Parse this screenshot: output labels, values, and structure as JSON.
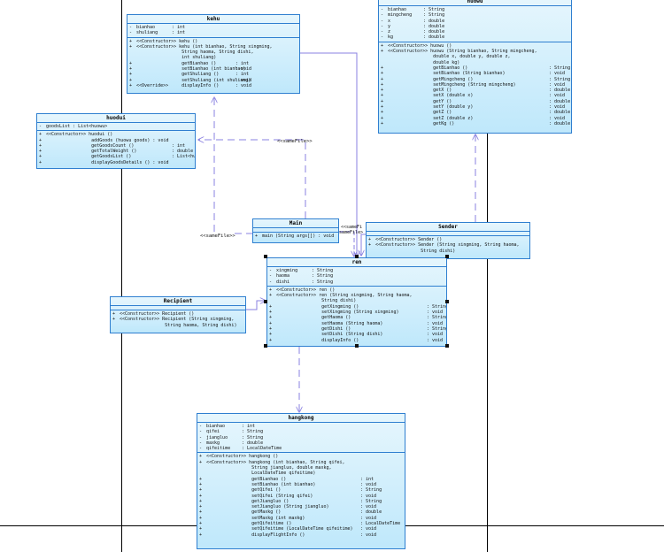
{
  "classes": {
    "kehu": {
      "name": "kehu",
      "attributes": [
        {
          "vis": "-",
          "name": "bianhao",
          "type": ": int"
        },
        {
          "vis": "-",
          "name": "shuliang",
          "type": ": int"
        }
      ],
      "operations": [
        {
          "vis": "+",
          "name": "<<Constructor>> kehu ()",
          "type": ""
        },
        {
          "vis": "+",
          "name": "<<Constructor>> kehu (int bianhao, String xingming,",
          "type": ""
        },
        {
          "vis": "",
          "name": "                 String haoma, String dishi,",
          "type": ""
        },
        {
          "vis": "",
          "name": "                 int shuliang)",
          "type": ""
        },
        {
          "vis": "+",
          "name": "                 getBianhao ()",
          "type": ": int"
        },
        {
          "vis": "+",
          "name": "                 setBianhao (int bianhao)",
          "type": ": void"
        },
        {
          "vis": "+",
          "name": "                 getShuliang ()",
          "type": ": int"
        },
        {
          "vis": "+",
          "name": "                 setShuliang (int shuliang)",
          "type": ": void"
        },
        {
          "vis": "+",
          "name": "<<Override>>     displayInfo ()",
          "type": ": void"
        }
      ]
    },
    "huowu": {
      "name": "huowu",
      "attributes": [
        {
          "vis": "-",
          "name": "bianhao",
          "type": ": String"
        },
        {
          "vis": "-",
          "name": "mingcheng",
          "type": ": String"
        },
        {
          "vis": "-",
          "name": "x",
          "type": ": double"
        },
        {
          "vis": "-",
          "name": "y",
          "type": ": double"
        },
        {
          "vis": "-",
          "name": "z",
          "type": ": double"
        },
        {
          "vis": "-",
          "name": "kg",
          "type": ": double"
        }
      ],
      "operations": [
        {
          "vis": "+",
          "name": "<<Constructor>> huowu ()",
          "type": ""
        },
        {
          "vis": "+",
          "name": "<<Constructor>> huowu (String bianhao, String mingcheng,",
          "type": ""
        },
        {
          "vis": "",
          "name": "                 double x, double y, double z,",
          "type": ""
        },
        {
          "vis": "",
          "name": "                 double kg)",
          "type": ""
        },
        {
          "vis": "+",
          "name": "                 getBianhao ()",
          "type": ": String"
        },
        {
          "vis": "+",
          "name": "                 setBianhao (String bianhao)",
          "type": ": void"
        },
        {
          "vis": "+",
          "name": "                 getMingcheng ()",
          "type": ": String"
        },
        {
          "vis": "+",
          "name": "                 setMingcheng (String mingcheng)",
          "type": ": void"
        },
        {
          "vis": "+",
          "name": "                 getX ()",
          "type": ": double"
        },
        {
          "vis": "+",
          "name": "                 setX (double x)",
          "type": ": void"
        },
        {
          "vis": "+",
          "name": "                 getY ()",
          "type": ": double"
        },
        {
          "vis": "+",
          "name": "                 setY (double y)",
          "type": ": void"
        },
        {
          "vis": "+",
          "name": "                 getZ ()",
          "type": ": double"
        },
        {
          "vis": "+",
          "name": "                 setZ (double z)",
          "type": ": void"
        },
        {
          "vis": "+",
          "name": "                 getKg ()",
          "type": ": double"
        }
      ]
    },
    "huodui": {
      "name": "huodui",
      "attributes": [
        {
          "vis": "-",
          "name": "goodsList : List<huowu>",
          "type": ""
        }
      ],
      "operations": [
        {
          "vis": "+",
          "name": "<<Constructor>> huodui ()",
          "type": ""
        },
        {
          "vis": "+",
          "name": "                 addGoods (huowu goods) : void",
          "type": ""
        },
        {
          "vis": "+",
          "name": "                 getGoodsCount ()",
          "type": ": int"
        },
        {
          "vis": "+",
          "name": "                 getTotalWeight ()",
          "type": ": double"
        },
        {
          "vis": "+",
          "name": "                 getGoodsList ()",
          "type": ": List<huowu>"
        },
        {
          "vis": "+",
          "name": "                 displayGoodsDetails () : void",
          "type": ""
        }
      ]
    },
    "main": {
      "name": "Main",
      "attributes": [],
      "operations": [
        {
          "vis": "+",
          "name": "main (String args[]) : void",
          "type": ""
        }
      ]
    },
    "sender": {
      "name": "Sender",
      "attributes": [],
      "operations": [
        {
          "vis": "+",
          "name": "<<Constructor>> Sender ()",
          "type": ""
        },
        {
          "vis": "+",
          "name": "<<Constructor>> Sender (String xingming, String haoma,",
          "type": ""
        },
        {
          "vis": "",
          "name": "                 String dishi)",
          "type": ""
        }
      ]
    },
    "ren": {
      "name": "ren",
      "attributes": [
        {
          "vis": "-",
          "name": "xingming",
          "type": ": String"
        },
        {
          "vis": "-",
          "name": "haoma",
          "type": ": String"
        },
        {
          "vis": "-",
          "name": "dishi",
          "type": ": String"
        }
      ],
      "operations": [
        {
          "vis": "+",
          "name": "<<Constructor>> ren ()",
          "type": ""
        },
        {
          "vis": "+",
          "name": "<<Constructor>> ren (String xingming, String haoma,",
          "type": ""
        },
        {
          "vis": "",
          "name": "                 String dishi)",
          "type": ""
        },
        {
          "vis": "+",
          "name": "                 getXingming ()",
          "type": ": String"
        },
        {
          "vis": "+",
          "name": "                 setXingming (String xingming)",
          "type": ": void"
        },
        {
          "vis": "+",
          "name": "                 getHaoma ()",
          "type": ": String"
        },
        {
          "vis": "+",
          "name": "                 setHaoma (String haoma)",
          "type": ": void"
        },
        {
          "vis": "+",
          "name": "                 getDishi ()",
          "type": ": String"
        },
        {
          "vis": "+",
          "name": "                 setDishi (String dishi)",
          "type": ": void"
        },
        {
          "vis": "+",
          "name": "                 displayInfo ()",
          "type": ": void"
        }
      ]
    },
    "recipient": {
      "name": "Recipient",
      "attributes": [],
      "operations": [
        {
          "vis": "+",
          "name": "<<Constructor>> Recipient ()",
          "type": ""
        },
        {
          "vis": "+",
          "name": "<<Constructor>> Recipient (String xingming,",
          "type": ""
        },
        {
          "vis": "",
          "name": "                 String haoma, String dishi)",
          "type": ""
        }
      ]
    },
    "hangkong": {
      "name": "hangkong",
      "attributes": [
        {
          "vis": "-",
          "name": "bianhao",
          "type": ": int"
        },
        {
          "vis": "-",
          "name": "qifei",
          "type": ": String"
        },
        {
          "vis": "-",
          "name": "jiangluo",
          "type": ": String"
        },
        {
          "vis": "-",
          "name": "maxkg",
          "type": ": double"
        },
        {
          "vis": "-",
          "name": "qifeitime",
          "type": ": LocalDateTime"
        }
      ],
      "operations": [
        {
          "vis": "+",
          "name": "<<Constructor>> hangkong ()",
          "type": ""
        },
        {
          "vis": "+",
          "name": "<<Constructor>> hangkong (int bianhao, String qifei,",
          "type": ""
        },
        {
          "vis": "",
          "name": "                 String jiangluo, double maxkg,",
          "type": ""
        },
        {
          "vis": "",
          "name": "                 LocalDateTime qifeitime)",
          "type": ""
        },
        {
          "vis": "+",
          "name": "                 getBianhao ()",
          "type": ": int"
        },
        {
          "vis": "+",
          "name": "                 setBianhao (int bianhao)",
          "type": ": void"
        },
        {
          "vis": "+",
          "name": "                 getQifei ()",
          "type": ": String"
        },
        {
          "vis": "+",
          "name": "                 setQifei (String qifei)",
          "type": ": void"
        },
        {
          "vis": "+",
          "name": "                 getJiangluo ()",
          "type": ": String"
        },
        {
          "vis": "+",
          "name": "                 setJiangluo (String jiangluo)",
          "type": ": void"
        },
        {
          "vis": "+",
          "name": "                 getMaxkg ()",
          "type": ": double"
        },
        {
          "vis": "+",
          "name": "                 setMaxkg (int maxkg)",
          "type": ": void"
        },
        {
          "vis": "+",
          "name": "                 getQifeitime ()",
          "type": ": LocalDateTime"
        },
        {
          "vis": "+",
          "name": "                 setQifeitime (LocalDateTime qifeitime)",
          "type": ": void"
        },
        {
          "vis": "+",
          "name": "                 displayFlightInfo ()",
          "type": ": void"
        }
      ]
    }
  },
  "labels": {
    "samefile_1": "<<sameFile>>",
    "samefile_2": "<<sameFile>>",
    "samefile_3": "<<sameFi",
    "samefile_4": "sameFile>"
  },
  "colors": {
    "class_border": "#2f7fd0",
    "class_fill_top": "#e6f6fd",
    "class_fill_bottom": "#bfe8fb",
    "dependency_line": "#8a80e0"
  }
}
